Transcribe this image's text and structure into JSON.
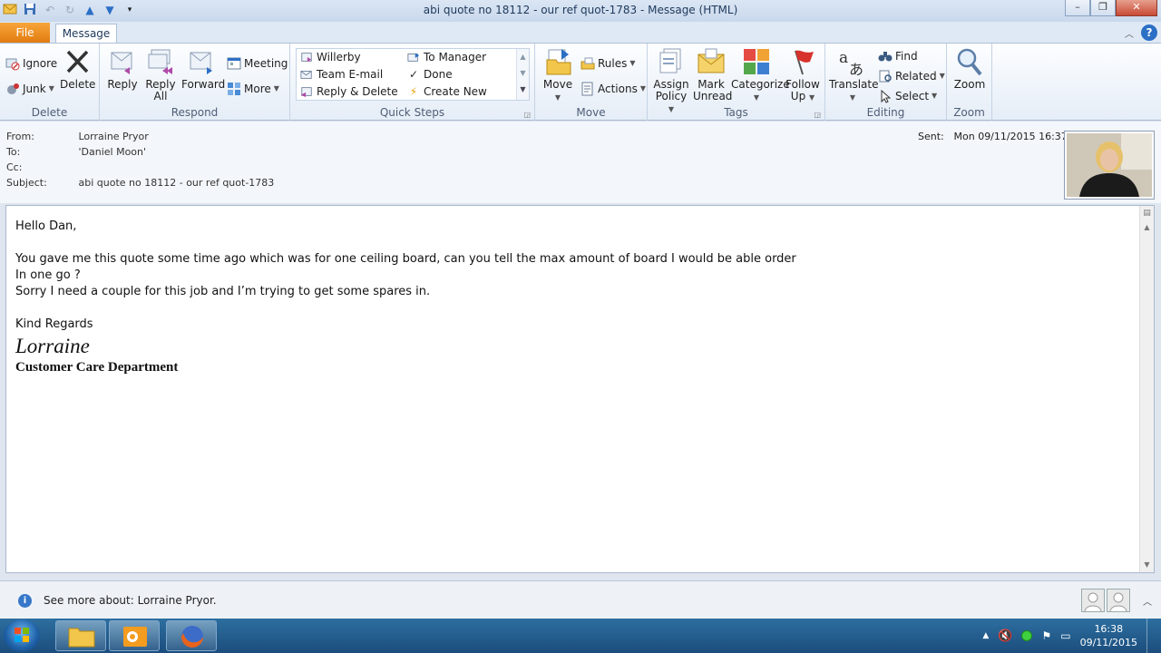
{
  "window": {
    "title": "abi quote no 18112 - our ref quot-1783  -  Message (HTML)"
  },
  "tabs": {
    "file": "File",
    "message": "Message"
  },
  "ribbon": {
    "delete_group": {
      "label": "Delete",
      "ignore": "Ignore",
      "junk": "Junk",
      "delete": "Delete"
    },
    "respond_group": {
      "label": "Respond",
      "reply": "Reply",
      "reply_all_line1": "Reply",
      "reply_all_line2": "All",
      "forward": "Forward",
      "meeting": "Meeting",
      "more": "More"
    },
    "quick_steps": {
      "label": "Quick Steps",
      "items": [
        "Willerby",
        "To Manager",
        "Team E-mail",
        "Done",
        "Reply & Delete",
        "Create New"
      ]
    },
    "move_group": {
      "label": "Move",
      "move": "Move",
      "rules": "Rules",
      "actions": "Actions"
    },
    "tags_group": {
      "label": "Tags",
      "assign_line1": "Assign",
      "assign_line2": "Policy",
      "mark_line1": "Mark",
      "mark_line2": "Unread",
      "categorize": "Categorize",
      "follow_line1": "Follow",
      "follow_line2": "Up"
    },
    "editing_group": {
      "label": "Editing",
      "translate": "Translate",
      "find": "Find",
      "related": "Related",
      "select": "Select"
    },
    "zoom_group": {
      "label": "Zoom",
      "zoom": "Zoom"
    }
  },
  "header": {
    "from_label": "From:",
    "from_value": "Lorraine Pryor",
    "to_label": "To:",
    "to_value": "'Daniel Moon'",
    "cc_label": "Cc:",
    "cc_value": "",
    "subject_label": "Subject:",
    "subject_value": "abi quote no 18112 - our ref quot-1783",
    "sent_label": "Sent:",
    "sent_value": "Mon 09/11/2015 16:37"
  },
  "body": {
    "greeting": "Hello Dan,",
    "line1": "You gave me this quote some time ago which was for one ceiling board, can you tell the max amount of board I would be able order",
    "line2": "In one go ?",
    "line3": "Sorry I need a couple for this job and I’m trying to get some spares in.",
    "closing": "Kind Regards",
    "signature_name": "Lorraine",
    "signature_dept": "Customer Care Department"
  },
  "people_pane": {
    "see_more": "See more about: Lorraine Pryor."
  },
  "taskbar": {
    "time": "16:38",
    "date": "09/11/2015"
  },
  "colors": {
    "file_tab": "#e47f12",
    "ribbon_bg": "#eef3fa",
    "taskbar": "#1f5485",
    "help": "#2b6fc5"
  }
}
